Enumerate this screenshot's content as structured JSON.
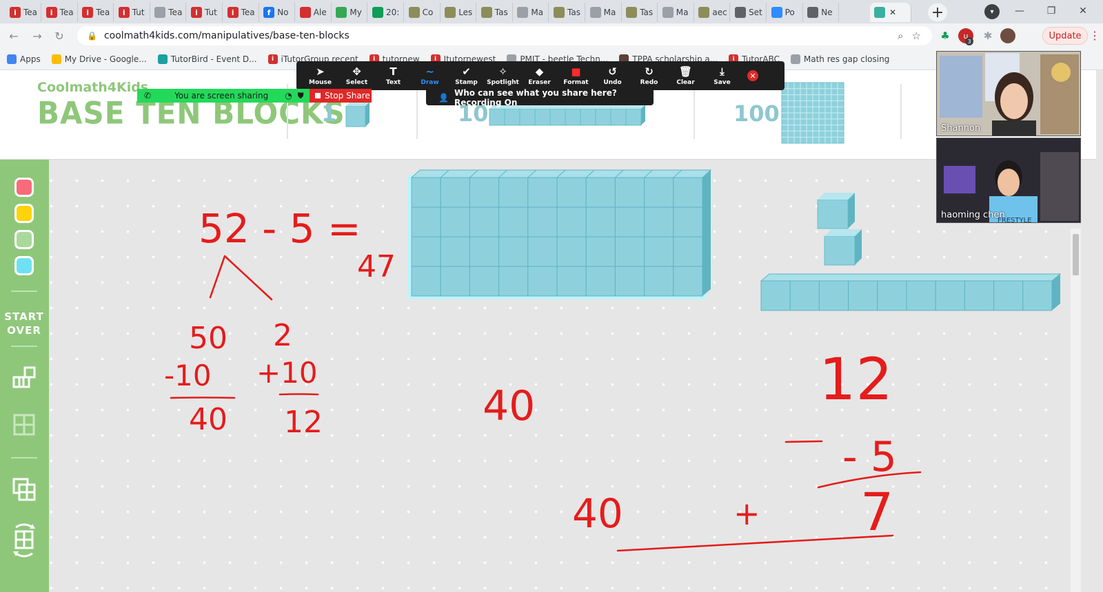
{
  "browser": {
    "tabs": [
      {
        "title": "Tea",
        "icon": "itutor-icon",
        "color": "#d32f2f"
      },
      {
        "title": "Tea",
        "icon": "itutor-icon",
        "color": "#d32f2f"
      },
      {
        "title": "Tea",
        "icon": "itutor-icon",
        "color": "#d32f2f"
      },
      {
        "title": "Tut",
        "icon": "itutor-icon",
        "color": "#d32f2f"
      },
      {
        "title": "Tea",
        "icon": "globe-icon",
        "color": "#9aa0a6"
      },
      {
        "title": "Tut",
        "icon": "itutor-icon",
        "color": "#d32f2f"
      },
      {
        "title": "Tea",
        "icon": "itutor-icon",
        "color": "#d32f2f"
      },
      {
        "title": "No",
        "icon": "facebook-icon",
        "color": "#1877f2"
      },
      {
        "title": "Ale",
        "icon": "maple-leaf-icon",
        "color": "#d32f2f"
      },
      {
        "title": "My",
        "icon": "drive-icon",
        "color": "#34a853"
      },
      {
        "title": "20:",
        "icon": "sheets-icon",
        "color": "#0f9d58"
      },
      {
        "title": "Co",
        "icon": "doc-icon",
        "color": "#8d8d5a"
      },
      {
        "title": "Les",
        "icon": "doc-icon",
        "color": "#8d8d5a"
      },
      {
        "title": "Tas",
        "icon": "doc-icon",
        "color": "#8d8d5a"
      },
      {
        "title": "Ma",
        "icon": "globe-icon",
        "color": "#9aa0a6"
      },
      {
        "title": "Tas",
        "icon": "doc-icon",
        "color": "#8d8d5a"
      },
      {
        "title": "Ma",
        "icon": "globe-icon",
        "color": "#9aa0a6"
      },
      {
        "title": "Tas",
        "icon": "doc-icon",
        "color": "#8d8d5a"
      },
      {
        "title": "Ma",
        "icon": "globe-icon",
        "color": "#9aa0a6"
      },
      {
        "title": "aec",
        "icon": "doc-icon",
        "color": "#8d8d5a"
      },
      {
        "title": "Set",
        "icon": "gear-icon",
        "color": "#5f6368"
      },
      {
        "title": "Po",
        "icon": "zoom-icon",
        "color": "#2d8cff"
      },
      {
        "title": "Ne",
        "icon": "globe-icon",
        "color": "#5f6368"
      }
    ],
    "active_tab": {
      "icon": "coolmath-icon",
      "color": "#3ab0a0"
    },
    "new_tab_label": "+",
    "url": "coolmath4kids.com/manipulatives/base-ten-blocks",
    "update_label": "Update",
    "ext_badge": "3",
    "bookmarks": [
      {
        "label": "Apps",
        "icon": "apps-icon",
        "color": "#4285f4"
      },
      {
        "label": "My Drive - Google...",
        "icon": "drive-icon",
        "color": "#fbbc04"
      },
      {
        "label": "TutorBird - Event D...",
        "icon": "tutorbird-icon",
        "color": "#1aa0a0"
      },
      {
        "label": "iTutorGroup recent",
        "icon": "itutor-icon",
        "color": "#d32f2f"
      },
      {
        "label": "tutornew",
        "icon": "itutor-icon",
        "color": "#d32f2f"
      },
      {
        "label": "Itutornewest",
        "icon": "itutor-icon",
        "color": "#d32f2f"
      },
      {
        "label": "PMIT - beetle Techn...",
        "icon": "globe-icon",
        "color": "#9aa0a6"
      },
      {
        "label": "TPPA scholarship a...",
        "icon": "paw-icon",
        "color": "#5d4037"
      },
      {
        "label": "TutorABC",
        "icon": "itutor-icon",
        "color": "#d32f2f"
      },
      {
        "label": "Math res gap closing",
        "icon": "globe-icon",
        "color": "#9aa0a6"
      }
    ]
  },
  "app": {
    "logo_small": "Coolmath4Kids",
    "title": "BASE TEN BLOCKS",
    "block_labels": [
      "1",
      "10",
      "100"
    ],
    "start_over": [
      "START",
      "OVER"
    ],
    "colors": {
      "green": "#8ec77a",
      "block": "#8ed1dc",
      "block_dark": "#5fb4c2",
      "ink": "#e51c1c"
    },
    "swatches": [
      "#f76b7b",
      "#ffd20a",
      "#a9d89b",
      "#6fe0f2"
    ]
  },
  "zoom": {
    "tools": [
      {
        "label": "Mouse",
        "icon": "cursor-icon",
        "glyph": "➤"
      },
      {
        "label": "Select",
        "icon": "move-icon",
        "glyph": "✥"
      },
      {
        "label": "Text",
        "icon": "text-icon",
        "glyph": "T"
      },
      {
        "label": "Draw",
        "icon": "draw-icon",
        "glyph": "∼"
      },
      {
        "label": "Stamp",
        "icon": "checkmark-icon",
        "glyph": "✔"
      },
      {
        "label": "Spotlight",
        "icon": "wand-icon",
        "glyph": "✧"
      },
      {
        "label": "Eraser",
        "icon": "eraser-icon",
        "glyph": "◆"
      },
      {
        "label": "Format",
        "icon": "format-color-icon",
        "glyph": "■"
      },
      {
        "label": "Undo",
        "icon": "undo-icon",
        "glyph": "↺"
      },
      {
        "label": "Redo",
        "icon": "redo-icon",
        "glyph": "↻"
      },
      {
        "label": "Clear",
        "icon": "trash-icon",
        "glyph": "🗑"
      },
      {
        "label": "Save",
        "icon": "save-icon",
        "glyph": "⤓"
      }
    ],
    "sharing_text": "You are screen sharing",
    "stop_share": "Stop Share",
    "who_can_see": "Who can see what you share here? Recording On",
    "participants": [
      "Shannon",
      "haoming   chen"
    ],
    "shirt_text": "FRESTYLE"
  },
  "handwriting": {
    "problem": "52 - 5 =",
    "answer": "47",
    "split_left": "50",
    "split_right": "2",
    "minus_ten": "-10",
    "plus_ten": "+10",
    "result_left": "40",
    "result_right": "12",
    "middle_value": "40",
    "right_top": "12",
    "right_sub": "- 5",
    "right_result": "7",
    "bottom_left": "40",
    "plus": "+"
  }
}
